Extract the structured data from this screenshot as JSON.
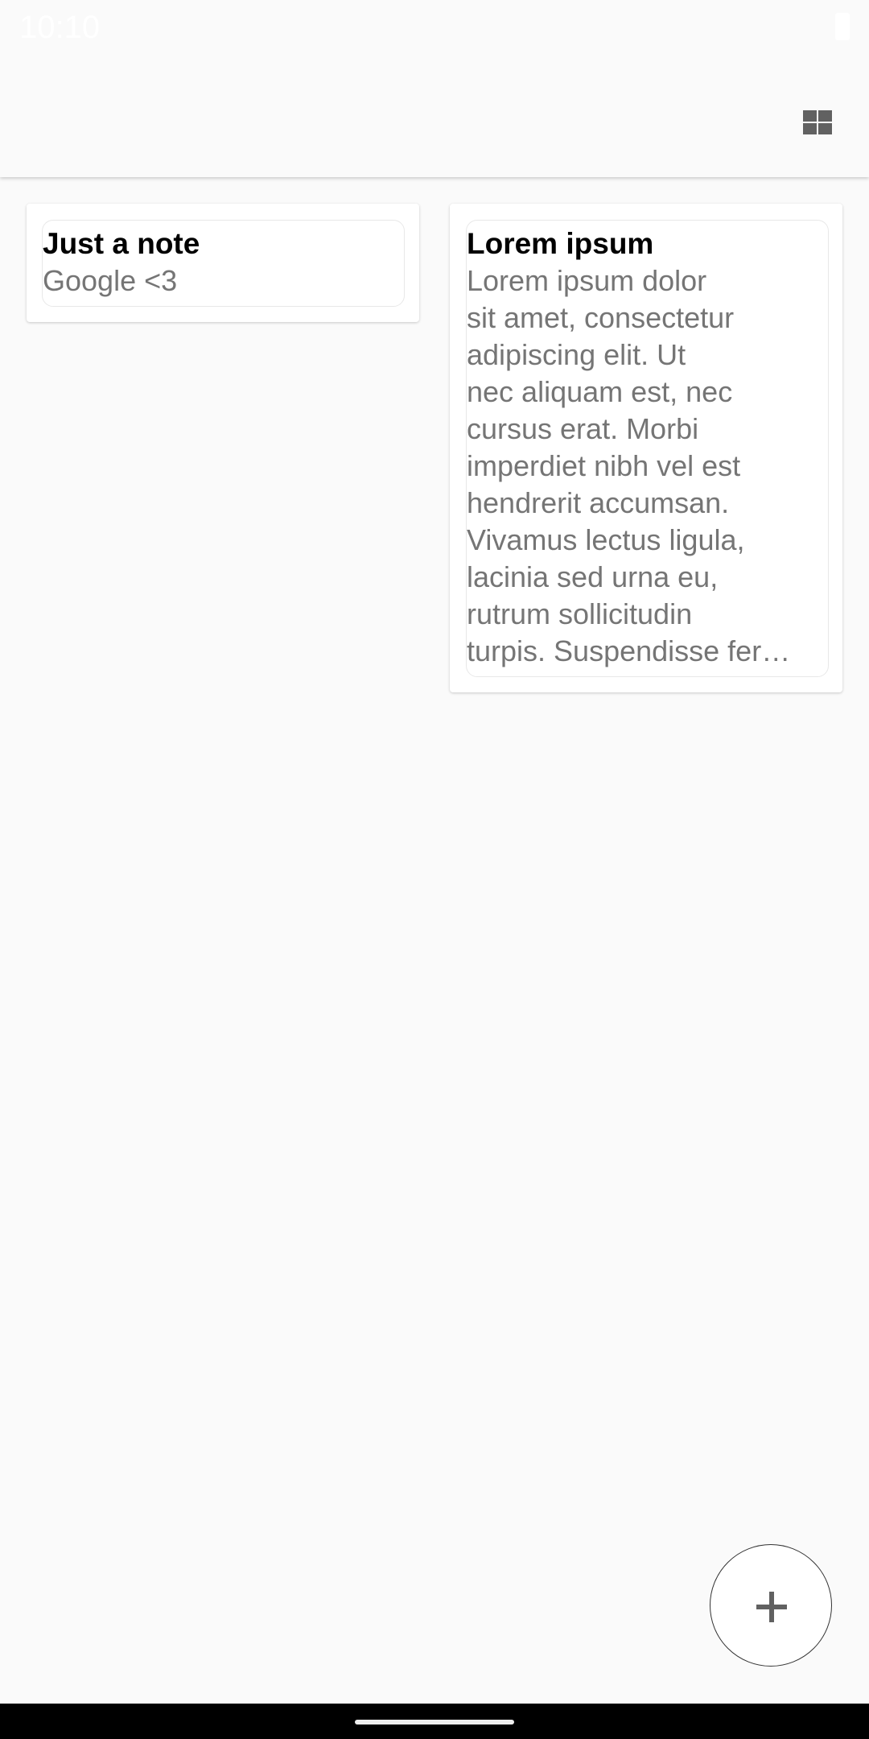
{
  "status_bar": {
    "time": "10:10"
  },
  "toolbar": {
    "layout_toggle_icon": "grid-view-icon"
  },
  "notes": [
    {
      "title": "Just a note",
      "body_lines": [
        "Google <3"
      ]
    },
    {
      "title": "Lorem ipsum",
      "body_lines": [
        "Lorem ipsum dolor",
        "sit amet, consectetur",
        "adipiscing elit. Ut",
        "nec aliquam est, nec",
        "cursus erat. Morbi",
        "imperdiet nibh vel est",
        "hendrerit accumsan.",
        "Vivamus lectus ligula,",
        "lacinia sed urna eu,",
        "rutrum sollicitudin",
        "turpis. Suspendisse fer…"
      ]
    }
  ],
  "fab": {
    "icon": "plus-icon"
  }
}
